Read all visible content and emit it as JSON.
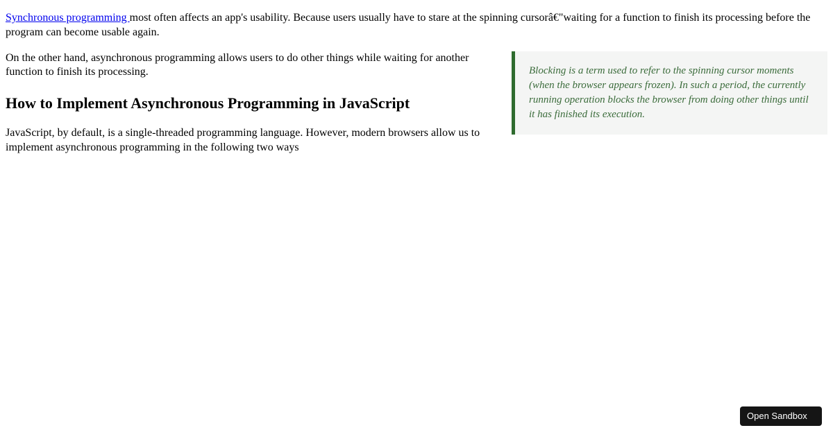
{
  "para1": {
    "link_text": "Synchronous programming ",
    "rest": "most often affects an app's usability. Because users usually have to stare at the spinning cursorâ€\"waiting for a function to finish its processing before the program can become usable again."
  },
  "para2": "On the other hand, asynchronous programming allows users to do other things while waiting for another function to finish its processing.",
  "heading": "How to Implement Asynchronous Programming in JavaScript",
  "para3": "JavaScript, by default, is a single-threaded programming language. However, modern browsers allow us to implement asynchronous programming in the following two ways",
  "callout": "Blocking is a term used to refer to the spinning cursor moments (when the browser appears frozen). In such a period, the currently running operation blocks the browser from doing other things until it has finished its execution.",
  "button": "Open Sandbox"
}
